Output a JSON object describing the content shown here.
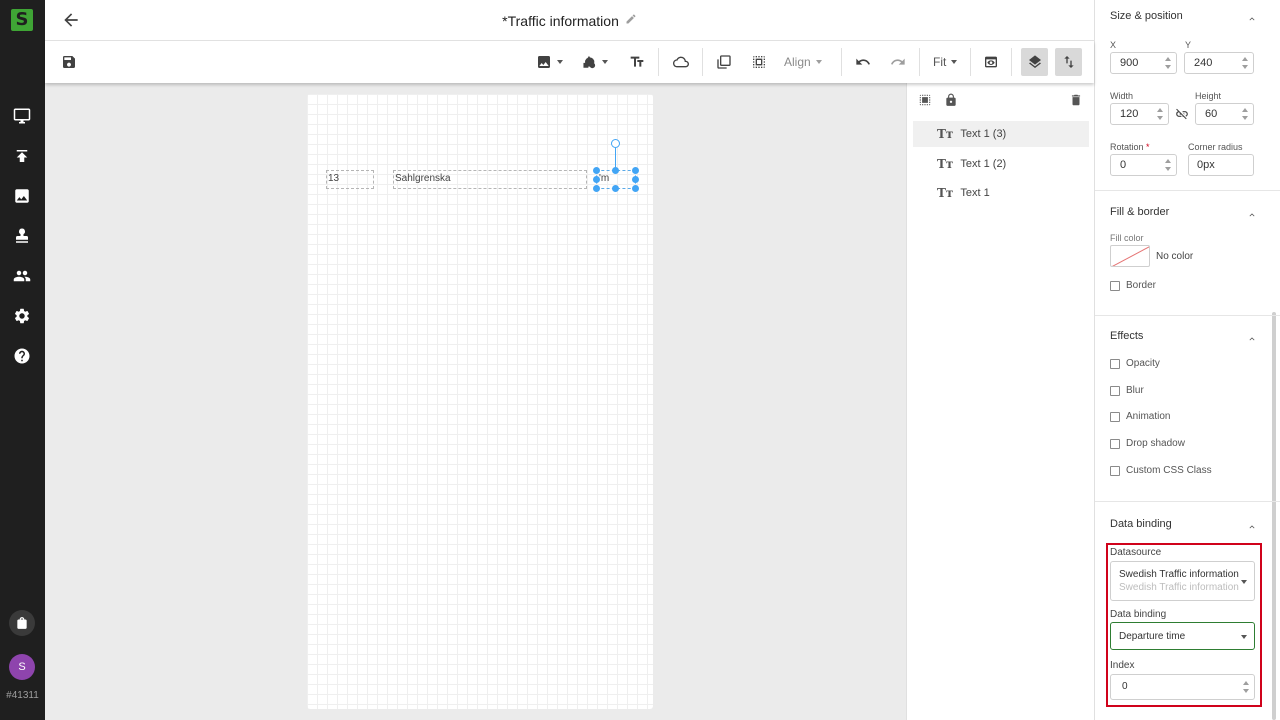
{
  "rail": {
    "logo_letter": "S",
    "avatar_initial": "S",
    "account_id": "#41311",
    "icons": [
      "monitor-icon",
      "upload-icon",
      "image-icon",
      "stamp-icon",
      "people-icon",
      "gear-icon",
      "help-icon",
      "bag-icon"
    ]
  },
  "header": {
    "title": "*Traffic information"
  },
  "toolbar": {
    "align_label": "Align",
    "zoom_label": "Fit"
  },
  "canvas": {
    "texts": [
      {
        "name": "Text 1",
        "value": "13"
      },
      {
        "name": "Text 1 (2)",
        "value": "Sahlgrenska"
      },
      {
        "name": "Text 1 (3)",
        "value": "'m"
      }
    ]
  },
  "layers": {
    "items": [
      "Text 1 (3)",
      "Text 1 (2)",
      "Text 1"
    ],
    "selected_index": 0
  },
  "props": {
    "size_position": {
      "heading": "Size & position",
      "x_label": "X",
      "x_value": "900",
      "y_label": "Y",
      "y_value": "240",
      "width_label": "Width",
      "width_value": "120",
      "height_label": "Height",
      "height_value": "60",
      "rotation_label": "Rotation",
      "rotation_marker": "*",
      "rotation_value": "0",
      "corner_label": "Corner radius",
      "corner_value": "0px"
    },
    "fill_border": {
      "heading": "Fill & border",
      "fill_label": "Fill color",
      "fill_value": "No color",
      "border_label": "Border"
    },
    "effects": {
      "heading": "Effects",
      "options": [
        "Opacity",
        "Blur",
        "Animation",
        "Drop shadow",
        "Custom CSS Class"
      ]
    },
    "data_binding": {
      "heading": "Data binding",
      "datasource_label": "Datasource",
      "datasource_value": "Swedish Traffic information - ",
      "datasource_sub": "Swedish Traffic information - ",
      "binding_label": "Data binding",
      "binding_value": "Departure time",
      "index_label": "Index",
      "index_value": "0"
    }
  },
  "colors": {
    "brand": "#3fa535",
    "selection": "#42a5f5",
    "highlight": "#d0021b",
    "binding_border": "#2e7d32"
  }
}
